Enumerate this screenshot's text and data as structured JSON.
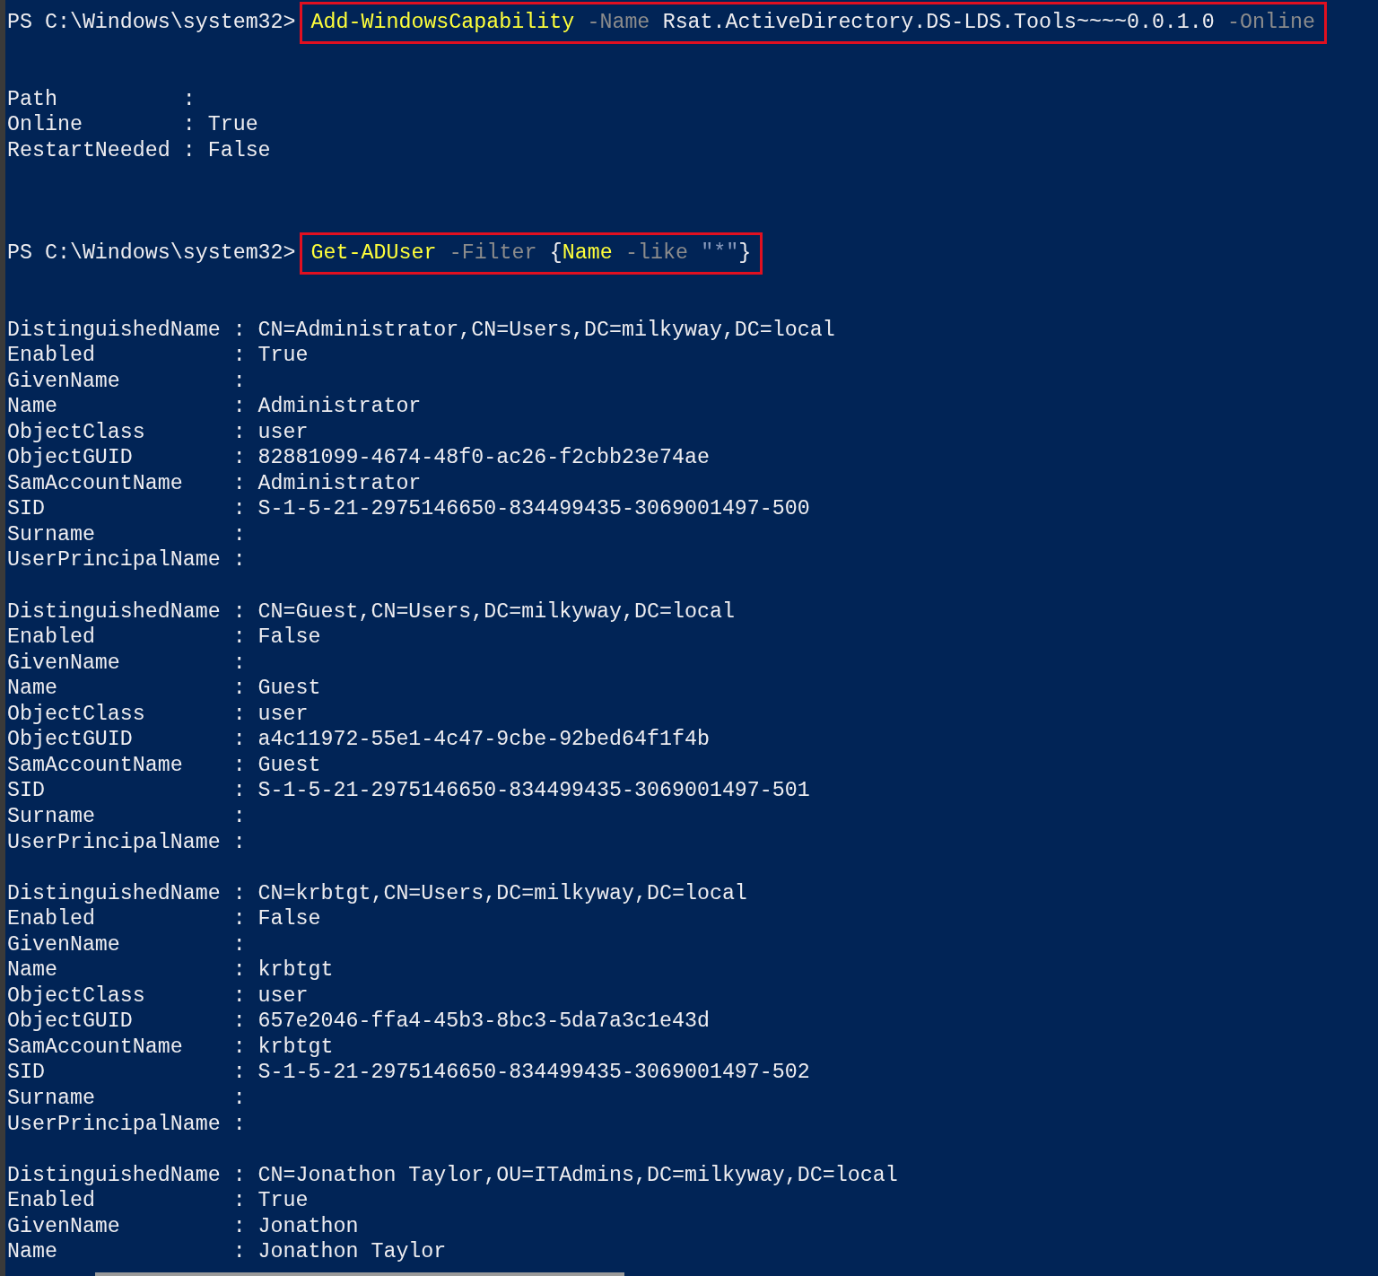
{
  "console": {
    "lines": [
      {
        "kind": "command",
        "prompt": "PS C:\\Windows\\system32>",
        "tokens": [
          {
            "kind": "cmdlet",
            "text": "Add-WindowsCapability"
          },
          {
            "kind": "parameter",
            "text": "-Name"
          },
          {
            "kind": "argument",
            "text": "Rsat.ActiveDirectory.DS-LDS.Tools~~~~0.0.1.0"
          },
          {
            "kind": "parameter",
            "text": "-Online"
          }
        ]
      },
      {
        "kind": "blank"
      },
      {
        "kind": "blank"
      },
      {
        "kind": "output",
        "text": "Path          :"
      },
      {
        "kind": "output",
        "text": "Online        : True"
      },
      {
        "kind": "output",
        "text": "RestartNeeded : False"
      },
      {
        "kind": "blank"
      },
      {
        "kind": "blank"
      },
      {
        "kind": "blank"
      },
      {
        "kind": "command",
        "prompt": "PS C:\\Windows\\system32>",
        "tokens": [
          {
            "kind": "cmdlet",
            "text": "Get-ADUser"
          },
          {
            "kind": "parameter",
            "text": "-Filter"
          },
          {
            "parts": [
              {
                "kind": "argument",
                "text": "{"
              },
              {
                "kind": "cmdlet",
                "text": "Name"
              }
            ]
          },
          {
            "kind": "parameter",
            "text": "-like"
          },
          {
            "parts": [
              {
                "kind": "string",
                "text": "\"*\""
              },
              {
                "kind": "argument",
                "text": "}"
              }
            ]
          }
        ]
      },
      {
        "kind": "blank"
      },
      {
        "kind": "blank"
      },
      {
        "kind": "output",
        "text": "DistinguishedName : CN=Administrator,CN=Users,DC=milkyway,DC=local"
      },
      {
        "kind": "output",
        "text": "Enabled           : True"
      },
      {
        "kind": "output",
        "text": "GivenName         :"
      },
      {
        "kind": "output",
        "text": "Name              : Administrator"
      },
      {
        "kind": "output",
        "text": "ObjectClass       : user"
      },
      {
        "kind": "output",
        "text": "ObjectGUID        : 82881099-4674-48f0-ac26-f2cbb23e74ae"
      },
      {
        "kind": "output",
        "text": "SamAccountName    : Administrator"
      },
      {
        "kind": "output",
        "text": "SID               : S-1-5-21-2975146650-834499435-3069001497-500"
      },
      {
        "kind": "output",
        "text": "Surname           :"
      },
      {
        "kind": "output",
        "text": "UserPrincipalName :"
      },
      {
        "kind": "blank"
      },
      {
        "kind": "output",
        "text": "DistinguishedName : CN=Guest,CN=Users,DC=milkyway,DC=local"
      },
      {
        "kind": "output",
        "text": "Enabled           : False"
      },
      {
        "kind": "output",
        "text": "GivenName         :"
      },
      {
        "kind": "output",
        "text": "Name              : Guest"
      },
      {
        "kind": "output",
        "text": "ObjectClass       : user"
      },
      {
        "kind": "output",
        "text": "ObjectGUID        : a4c11972-55e1-4c47-9cbe-92bed64f1f4b"
      },
      {
        "kind": "output",
        "text": "SamAccountName    : Guest"
      },
      {
        "kind": "output",
        "text": "SID               : S-1-5-21-2975146650-834499435-3069001497-501"
      },
      {
        "kind": "output",
        "text": "Surname           :"
      },
      {
        "kind": "output",
        "text": "UserPrincipalName :"
      },
      {
        "kind": "blank"
      },
      {
        "kind": "output",
        "text": "DistinguishedName : CN=krbtgt,CN=Users,DC=milkyway,DC=local"
      },
      {
        "kind": "output",
        "text": "Enabled           : False"
      },
      {
        "kind": "output",
        "text": "GivenName         :"
      },
      {
        "kind": "output",
        "text": "Name              : krbtgt"
      },
      {
        "kind": "output",
        "text": "ObjectClass       : user"
      },
      {
        "kind": "output",
        "text": "ObjectGUID        : 657e2046-ffa4-45b3-8bc3-5da7a3c1e43d"
      },
      {
        "kind": "output",
        "text": "SamAccountName    : krbtgt"
      },
      {
        "kind": "output",
        "text": "SID               : S-1-5-21-2975146650-834499435-3069001497-502"
      },
      {
        "kind": "output",
        "text": "Surname           :"
      },
      {
        "kind": "output",
        "text": "UserPrincipalName :"
      },
      {
        "kind": "blank"
      },
      {
        "kind": "output",
        "text": "DistinguishedName : CN=Jonathon Taylor,OU=ITAdmins,DC=milkyway,DC=local"
      },
      {
        "kind": "output",
        "text": "Enabled           : True"
      },
      {
        "kind": "output",
        "text": "GivenName         : Jonathon"
      },
      {
        "kind": "output",
        "text": "Name              : Jonathon Taylor"
      }
    ]
  }
}
